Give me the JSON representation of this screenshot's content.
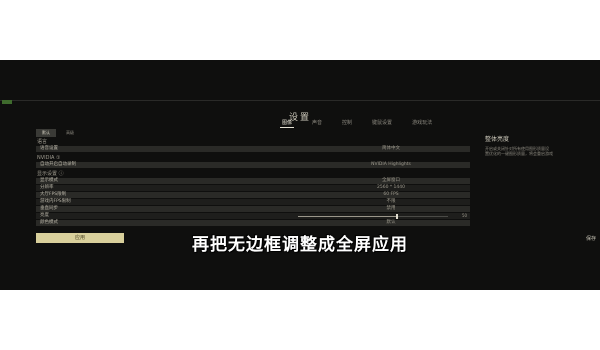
{
  "window": {
    "title": "设置"
  },
  "tabs": [
    {
      "label": "图像"
    },
    {
      "label": "声音"
    },
    {
      "label": "控制"
    },
    {
      "label": "键鼠设置"
    },
    {
      "label": "游戏玩法"
    }
  ],
  "preset_buttons": {
    "primary": "默认",
    "secondary": "高级"
  },
  "sections": {
    "language": "语言",
    "nvidia": "NVIDIA ①",
    "display": "显示设置 ⓘ"
  },
  "rows": {
    "voice_language": {
      "label": "语音设置",
      "value": "简体中文"
    },
    "highlights": {
      "label": "自动开启自动录制",
      "value": "NVIDIA Highlights"
    },
    "display_mode": {
      "label": "显示模式",
      "value": "全屏窗口"
    },
    "resolution": {
      "label": "分辨率",
      "value": "2560 * 1440"
    },
    "fps_limit": {
      "label": "大厅FPS限制",
      "value": "60 FPS"
    },
    "ingame_fps": {
      "label": "游戏内FPS限制",
      "value": "不限"
    },
    "vsync": {
      "label": "垂直同步",
      "value": "禁用"
    },
    "brightness": {
      "label": "亮度",
      "value": "50"
    },
    "color_mode": {
      "label": "颜色模式",
      "value": "默认"
    }
  },
  "brightness_fraction": 0.66,
  "description": {
    "title": "整体亮度",
    "lines": [
      "开启或关闭针对所有使用图形质量设",
      "置优化的一键图形质量，将会重启游戏"
    ]
  },
  "apply_button": "应用",
  "subtitle": "再把无边框调整成全屏应用",
  "corner_text": "保存"
}
